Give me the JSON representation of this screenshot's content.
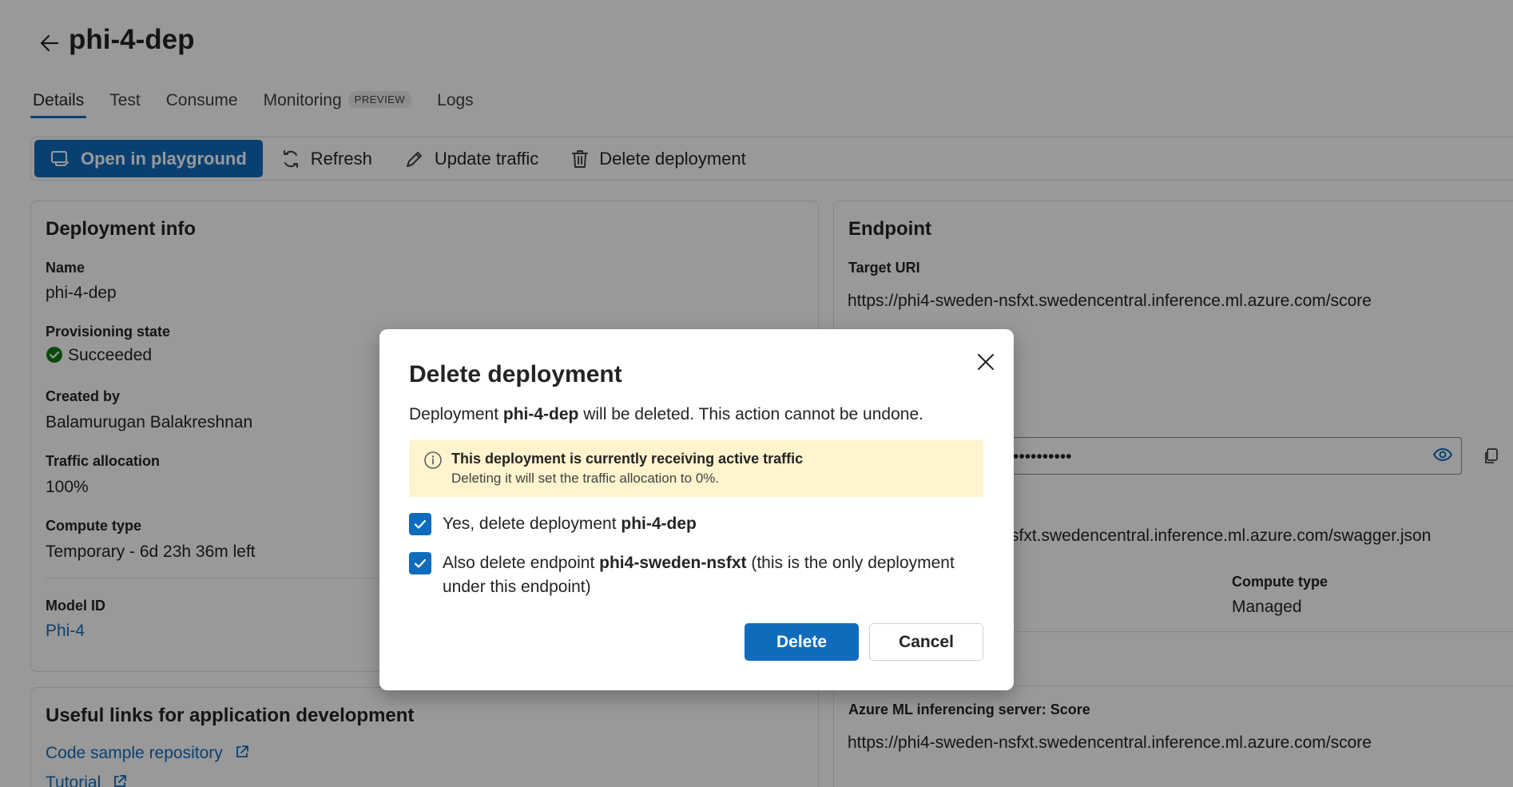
{
  "header": {
    "title": "phi-4-dep"
  },
  "tabs": [
    {
      "label": "Details"
    },
    {
      "label": "Test"
    },
    {
      "label": "Consume"
    },
    {
      "label": "Monitoring",
      "badge": "PREVIEW"
    },
    {
      "label": "Logs"
    }
  ],
  "toolbar": {
    "open_playground": "Open in playground",
    "refresh": "Refresh",
    "update_traffic": "Update traffic",
    "delete_deployment": "Delete deployment"
  },
  "deployment_info": {
    "title": "Deployment info",
    "name_label": "Name",
    "name_value": "phi-4-dep",
    "provisioning_label": "Provisioning state",
    "provisioning_value": "Succeeded",
    "created_by_label": "Created by",
    "created_by_value": "Balamurugan Balakreshnan",
    "traffic_label": "Traffic allocation",
    "traffic_value": "100%",
    "compute_label": "Compute type",
    "compute_value": "Temporary - 6d 23h 36m left",
    "model_label": "Model ID",
    "model_value": "Phi-4"
  },
  "endpoint": {
    "title": "Endpoint",
    "target_uri_label": "Target URI",
    "target_uri_value": "https://phi4-sweden-nsfxt.swedencentral.inference.ml.azure.com/score",
    "key_masked": "••••••••••",
    "swagger_partial": "sfxt.swedencentral.inference.ml.azure.com/swagger.json",
    "compute_type_label": "Compute type",
    "compute_type_value": "Managed",
    "server_label": "Azure ML inferencing server: Score",
    "server_value": "https://phi4-sweden-nsfxt.swedencentral.inference.ml.azure.com/score"
  },
  "useful_links": {
    "title": "Useful links for application development",
    "code_sample": "Code sample repository",
    "tutorial": "Tutorial"
  },
  "dialog": {
    "title": "Delete deployment",
    "msg_prefix": "Deployment ",
    "msg_name": "phi-4-dep",
    "msg_suffix": " will be deleted. This action cannot be undone.",
    "warning_title": "This deployment is currently receiving active traffic",
    "warning_sub": "Deleting it will set the traffic allocation to 0%.",
    "check1_prefix": "Yes, delete deployment ",
    "check1_name": "phi-4-dep",
    "check2_prefix": "Also delete endpoint ",
    "check2_name": "phi4-sweden-nsfxt",
    "check2_suffix": " (this is the only deployment under this endpoint)",
    "delete_label": "Delete",
    "cancel_label": "Cancel"
  },
  "colors": {
    "accent": "#0f6cbd",
    "success": "#107c10",
    "warning_bg": "#fff4ce"
  }
}
